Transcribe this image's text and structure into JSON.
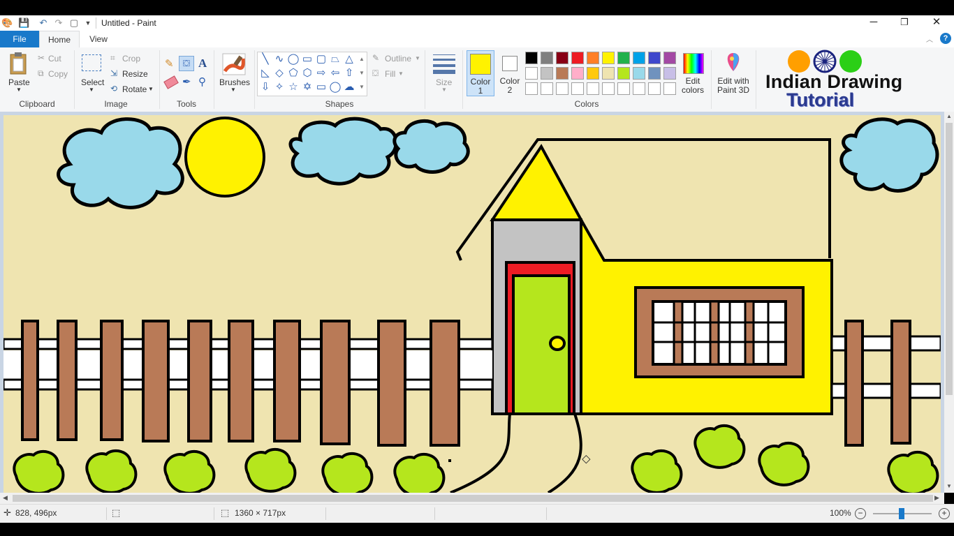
{
  "window": {
    "title": "Untitled - Paint",
    "controls": {
      "minimize": "─",
      "restore": "❐",
      "close": "✕"
    }
  },
  "tabs": [
    {
      "label": "File"
    },
    {
      "label": "Home"
    },
    {
      "label": "View"
    }
  ],
  "ribbon": {
    "clipboard": {
      "paste": "Paste",
      "cut": "Cut",
      "copy": "Copy",
      "group": "Clipboard"
    },
    "image": {
      "select": "Select",
      "crop": "Crop",
      "resize": "Resize",
      "rotate": "Rotate",
      "group": "Image"
    },
    "tools": {
      "group": "Tools",
      "text_glyph": "A"
    },
    "brushes": {
      "label": "Brushes"
    },
    "shapes": {
      "group": "Shapes",
      "outline": "Outline",
      "fill": "Fill"
    },
    "size": {
      "label": "Size"
    },
    "colors": {
      "color1": "Color\n1",
      "color2": "Color\n2",
      "color1_value": "#fff200",
      "color2_value": "#ffffff",
      "edit_colors": "Edit\ncolors",
      "edit_3d": "Edit with\nPaint 3D",
      "group": "Colors",
      "palette": [
        "#000000",
        "#7f7f7f",
        "#880015",
        "#ed1c24",
        "#ff7f27",
        "#fff200",
        "#22b14c",
        "#00a2e8",
        "#3f48cc",
        "#a349a4",
        "#ffffff",
        "#c3c3c3",
        "#b97a57",
        "#ffaec9",
        "#ffc90e",
        "#efe4b0",
        "#b5e61d",
        "#99d9ea",
        "#7092be",
        "#c8bfe7"
      ]
    }
  },
  "watermark": {
    "line1": "Indian Drawing",
    "line2": "Tutorial",
    "dots": [
      "#ff9f00",
      "#1a237e",
      "#2bcf16"
    ]
  },
  "drawing": {
    "background": "#efe4b0",
    "sky_blue": "#99d9ea",
    "yellow": "#fff200",
    "brown": "#b97a57",
    "green": "#b5e61d",
    "gray": "#c3c3c3",
    "red": "#ed1c24"
  },
  "status": {
    "cursor": "828, 496px",
    "canvas_size": "1360 × 717px",
    "zoom": "100%"
  }
}
